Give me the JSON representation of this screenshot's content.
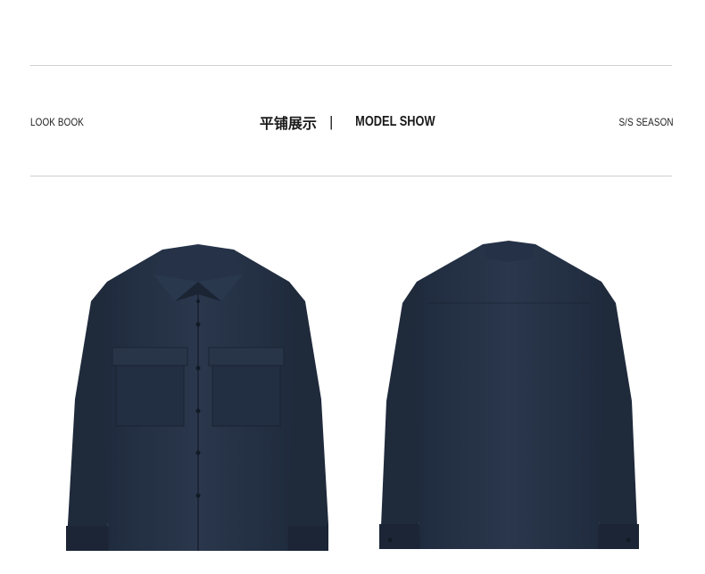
{
  "header": {
    "left_label": "LOOK BOOK",
    "center_cn": "平铺展示",
    "separator": "|",
    "center_en": "MODEL SHOW",
    "right_label": "S/S SEASON"
  },
  "products": [
    {
      "view": "front",
      "icon": "navy-shirt-front-image",
      "color": "#263347"
    },
    {
      "view": "back",
      "icon": "navy-shirt-back-image",
      "color": "#263347"
    }
  ]
}
